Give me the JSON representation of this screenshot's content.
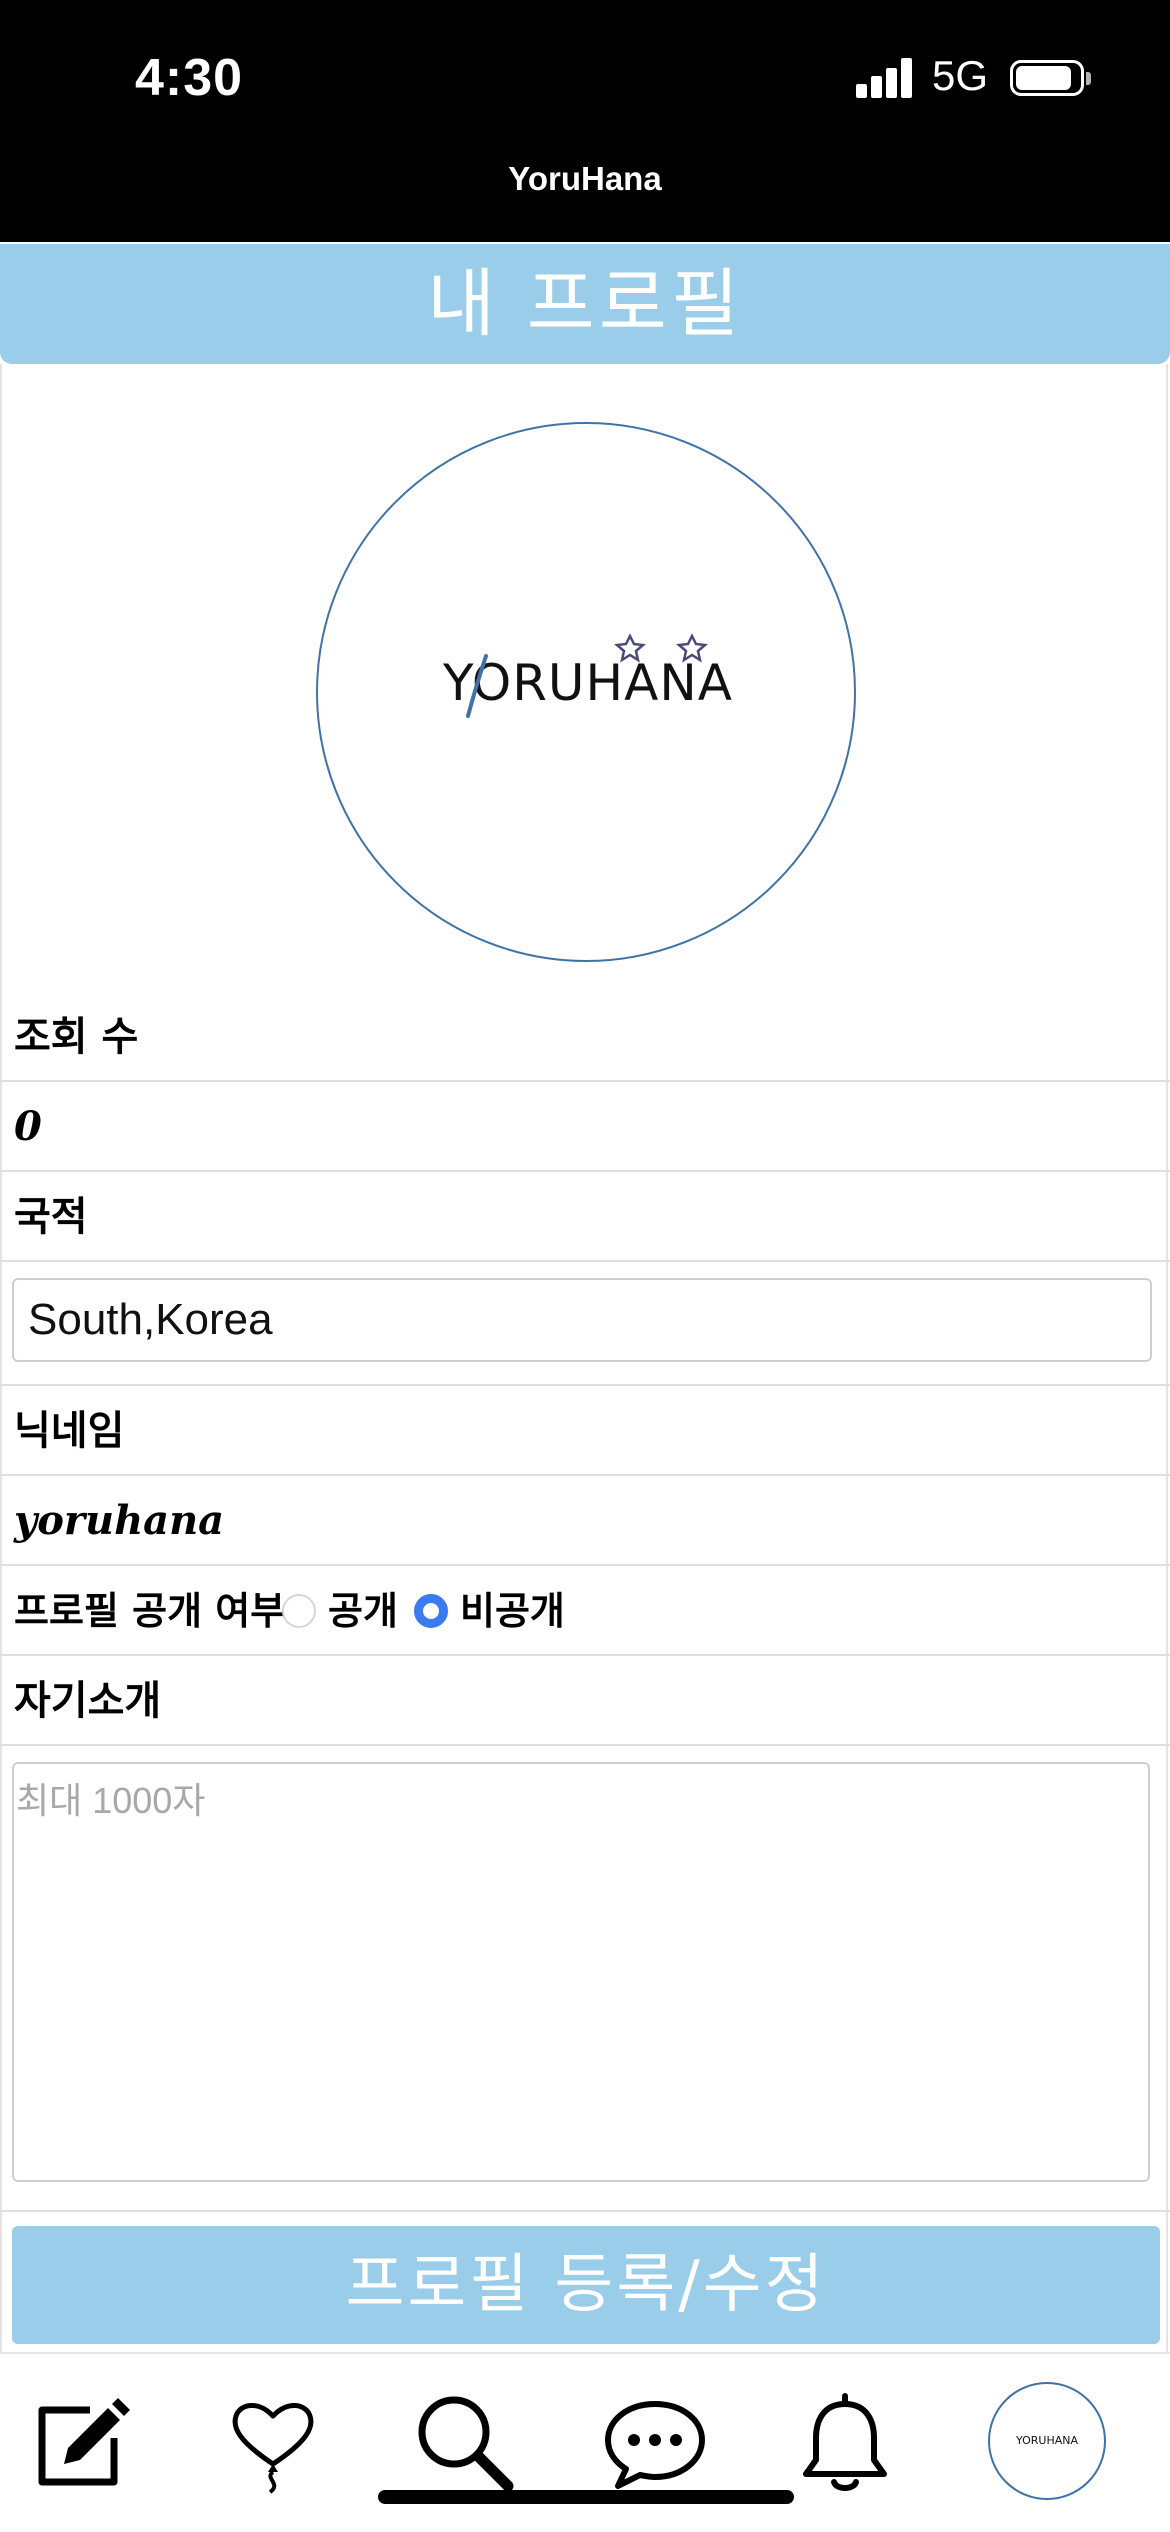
{
  "status_bar": {
    "time": "4:30",
    "network": "5G",
    "battery_level": 0.88
  },
  "app": {
    "title": "YoruHana"
  },
  "header": {
    "title": "내 프로필"
  },
  "profile": {
    "avatar_logo_text": "YORUHANA",
    "views_label": "조회 수",
    "views_value": "0",
    "nationality_label": "국적",
    "nationality_value": "South,Korea",
    "nickname_label": "닉네임",
    "nickname_value": "yoruhana",
    "visibility_label": "프로필 공개 여부",
    "visibility_options": [
      "공개",
      "비공개"
    ],
    "visibility_selected": "비공개",
    "bio_label": "자기소개",
    "bio_placeholder": "최대 1000자",
    "submit_label": "프로필 등록/수정"
  },
  "tabbar": {
    "items": [
      "edit-icon",
      "heart-balloon-icon",
      "search-icon",
      "chat-bubble-icon",
      "bell-icon",
      "profile-avatar"
    ],
    "avatar_text": "YORUHANA"
  },
  "colors": {
    "accent": "#99cde9",
    "avatar_border": "#3f73a8",
    "radio_selected": "#3a7bf2"
  }
}
